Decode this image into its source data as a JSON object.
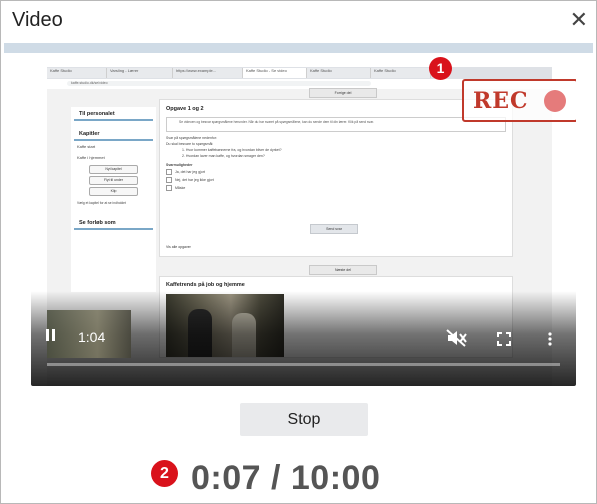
{
  "dialog": {
    "title": "Video",
    "close_glyph": "✕"
  },
  "recording_preview": {
    "browser_tabs": [
      "Kaffe Studio",
      "Varsling - Lærer",
      "https://www.example...",
      "Kaffe Studio - Se video",
      "Kaffe Studio",
      "Kaffe Studio"
    ],
    "address": "kaffe.studio.dk/se/video",
    "sidebar": {
      "heading": "Til personalet",
      "chapters_heading": "Kapitler",
      "chapter_rows": [
        "Kaffe start",
        "Kaffe i hjemmet"
      ],
      "buttons": [
        "Nyt kapitel",
        "Flyt til under",
        "Klip"
      ],
      "note": "Vælg et kapitel for at se indholdet",
      "section": "Se forløb som"
    },
    "prev_label": "Forrige del",
    "next_label": "Næste del",
    "task_card": {
      "title": "Opgave 1 og 2",
      "note": "Se videoen og besvar spørgsmålene herunder. Når du har svaret på spørgsmålene, kan du sende dem til din lærer. Klik på send svar.",
      "lines": [
        "Svar på spørgsmålene nedenfor:",
        "Du skal besvare to spørgsmål:"
      ],
      "questions": [
        "1. Hvor kommer kaffebønnerne fra, og hvordan bliver de dyrket?",
        "2. Hvordan laver man kaffe, og hvordan smager den?"
      ],
      "checks_label": "Svarmuligheder",
      "checks": [
        "Ja, det har jeg gjort",
        "Nej, det har jeg ikke gjort",
        "Måske"
      ],
      "send": "Send svar",
      "show_all": "Vis alle opgaver"
    },
    "video_card_title": "Kaffetrends på job og hjemme",
    "rec_label": "REC"
  },
  "player": {
    "current_time": "1:04",
    "progress": 0.0,
    "icons": [
      "pause-icon",
      "mute-icon",
      "fullscreen-icon",
      "more-icon"
    ]
  },
  "controls": {
    "stop_label": "Stop"
  },
  "timer": {
    "text": "0:07 / 10:00"
  },
  "badges": {
    "one": "1",
    "two": "2"
  },
  "colors": {
    "accent_red": "#d9121b",
    "rec_red": "#c0392b",
    "divider": "#cfdbe6"
  }
}
